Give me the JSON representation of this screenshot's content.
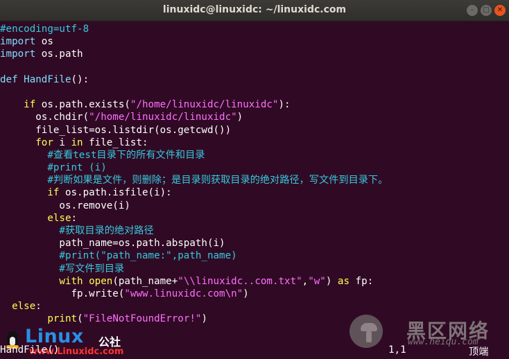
{
  "window": {
    "title": "linuxidc@linuxidc: ~/linuxidc.com",
    "minimize_glyph": "–",
    "maximize_glyph": "□",
    "close_glyph": "✕"
  },
  "code_lines": [
    [
      {
        "c": "cm",
        "t": "#encoding=utf-8"
      }
    ],
    [
      {
        "c": "kw",
        "t": "import"
      },
      {
        "c": "plain",
        "t": " os"
      }
    ],
    [
      {
        "c": "kw",
        "t": "import"
      },
      {
        "c": "plain",
        "t": " os.path"
      }
    ],
    [],
    [
      {
        "c": "kw",
        "t": "def"
      },
      {
        "c": "plain",
        "t": " "
      },
      {
        "c": "fn",
        "t": "HandFile"
      },
      {
        "c": "plain",
        "t": "():"
      }
    ],
    [],
    [
      {
        "c": "plain",
        "t": "    "
      },
      {
        "c": "def",
        "t": "if"
      },
      {
        "c": "plain",
        "t": " os.path.exists("
      },
      {
        "c": "str",
        "t": "\"/home/linuxidc/linuxidc\""
      },
      {
        "c": "plain",
        "t": "):"
      }
    ],
    [
      {
        "c": "plain",
        "t": "      os.chdir("
      },
      {
        "c": "str",
        "t": "\"/home/linuxidc/linuxidc\""
      },
      {
        "c": "plain",
        "t": ")"
      }
    ],
    [
      {
        "c": "plain",
        "t": "      file_list=os.listdir(os.getcwd())"
      }
    ],
    [
      {
        "c": "plain",
        "t": "      "
      },
      {
        "c": "def",
        "t": "for"
      },
      {
        "c": "plain",
        "t": " i "
      },
      {
        "c": "def",
        "t": "in"
      },
      {
        "c": "plain",
        "t": " file_list:"
      }
    ],
    [
      {
        "c": "plain",
        "t": "        "
      },
      {
        "c": "cm",
        "t": "#查看test目录下的所有文件和目录"
      }
    ],
    [
      {
        "c": "plain",
        "t": "        "
      },
      {
        "c": "cm",
        "t": "#print (i)"
      }
    ],
    [
      {
        "c": "plain",
        "t": "        "
      },
      {
        "c": "cm",
        "t": "#判断如果是文件，则删除；是目录则获取目录的绝对路径，写文件到目录下。"
      }
    ],
    [
      {
        "c": "plain",
        "t": "        "
      },
      {
        "c": "def",
        "t": "if"
      },
      {
        "c": "plain",
        "t": " os.path.isfile(i):"
      }
    ],
    [
      {
        "c": "plain",
        "t": "          os.remove(i)"
      }
    ],
    [
      {
        "c": "plain",
        "t": "        "
      },
      {
        "c": "def",
        "t": "else"
      },
      {
        "c": "plain",
        "t": ":"
      }
    ],
    [
      {
        "c": "plain",
        "t": "          "
      },
      {
        "c": "cm",
        "t": "#获取目录的绝对路径"
      }
    ],
    [
      {
        "c": "plain",
        "t": "          path_name=os.path.abspath(i)"
      }
    ],
    [
      {
        "c": "plain",
        "t": "          "
      },
      {
        "c": "cm",
        "t": "#print(\"path_name:\",path_name)"
      }
    ],
    [
      {
        "c": "plain",
        "t": "          "
      },
      {
        "c": "cm",
        "t": "#写文件到目录"
      }
    ],
    [
      {
        "c": "plain",
        "t": "          "
      },
      {
        "c": "def",
        "t": "with"
      },
      {
        "c": "plain",
        "t": " "
      },
      {
        "c": "def",
        "t": "open"
      },
      {
        "c": "plain",
        "t": "(path_name+"
      },
      {
        "c": "str",
        "t": "\"\\\\linuxidc..com.txt\""
      },
      {
        "c": "plain",
        "t": ","
      },
      {
        "c": "str",
        "t": "\"w\""
      },
      {
        "c": "plain",
        "t": ") "
      },
      {
        "c": "def",
        "t": "as"
      },
      {
        "c": "plain",
        "t": " fp:"
      }
    ],
    [
      {
        "c": "plain",
        "t": "            fp.write("
      },
      {
        "c": "str",
        "t": "\"www.linuxidc.com\\n\""
      },
      {
        "c": "plain",
        "t": ")"
      }
    ],
    [
      {
        "c": "plain",
        "t": "  "
      },
      {
        "c": "def",
        "t": "else"
      },
      {
        "c": "plain",
        "t": ":"
      }
    ],
    [
      {
        "c": "plain",
        "t": "        "
      },
      {
        "c": "def",
        "t": "print"
      },
      {
        "c": "plain",
        "t": "("
      },
      {
        "c": "str",
        "t": "\"FileNotFoundError!\""
      },
      {
        "c": "plain",
        "t": ")"
      }
    ]
  ],
  "status": {
    "left_text": "HandFile()",
    "position": "1,1",
    "scroll": "顶端"
  },
  "watermark_left": {
    "brand": "Linux",
    "suffix": "公社",
    "url": "www.Linuxidc.com"
  },
  "watermark_right": {
    "brand": "黑区网络",
    "url": "www.heiqu.com"
  },
  "colors": {
    "background": "#300a24",
    "keyword": "#ffff54",
    "builtin": "#7fdfff",
    "string": "#ff6fff",
    "comment": "#36c9de",
    "close_button": "#e9541f"
  }
}
